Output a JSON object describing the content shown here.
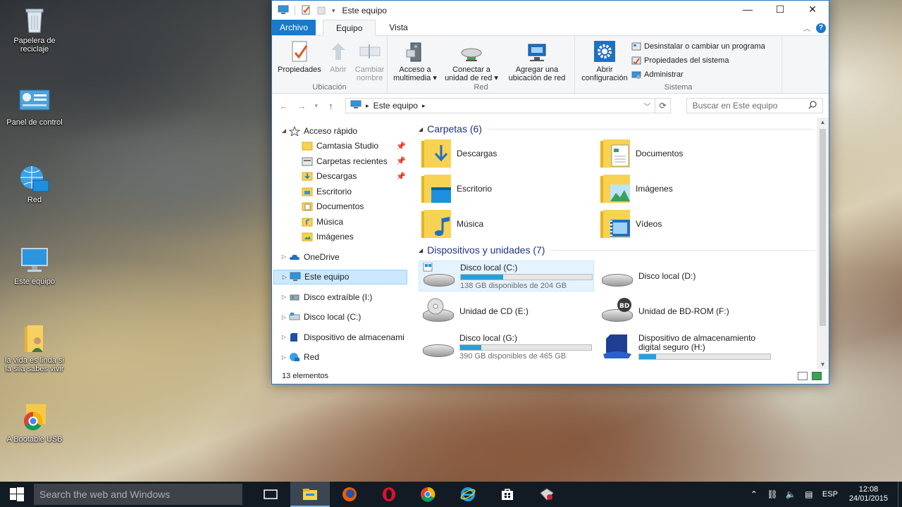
{
  "desktop": {
    "icons": [
      {
        "label": "Papelera de reciclaje"
      },
      {
        "label": "Panel de control"
      },
      {
        "label": "Red"
      },
      {
        "label": "Este equipo"
      },
      {
        "label": "la vida es linda si la sila sabes vivir"
      },
      {
        "label": "A Bootable USB"
      }
    ]
  },
  "window": {
    "title": "Este equipo",
    "controls": {
      "minimize": "—",
      "maximize": "☐",
      "close": "✕"
    },
    "tabs": {
      "file": "Archivo",
      "computer": "Equipo",
      "view": "Vista"
    },
    "ribbon": {
      "ubicacion": {
        "label": "Ubicación",
        "buttons": [
          {
            "label": "Propiedades"
          },
          {
            "label": "Abrir"
          },
          {
            "label": "Cambiar nombre"
          }
        ]
      },
      "red": {
        "label": "Red",
        "buttons": [
          {
            "label": "Acceso a multimedia ▾"
          },
          {
            "label": "Conectar a unidad de red ▾"
          },
          {
            "label": "Agregar una ubicación de red"
          }
        ]
      },
      "sistema": {
        "label": "Sistema",
        "open_settings": "Abrir configuración",
        "items": [
          {
            "label": "Desinstalar o cambiar un programa"
          },
          {
            "label": "Propiedades del sistema"
          },
          {
            "label": "Administrar"
          }
        ]
      }
    },
    "address": {
      "path": "Este equipo",
      "search_placeholder": "Buscar en Este equipo"
    },
    "nav": {
      "quick_access": "Acceso rápido",
      "quick_items": [
        {
          "label": "Camtasia Studio"
        },
        {
          "label": "Carpetas recientes"
        },
        {
          "label": "Descargas"
        },
        {
          "label": "Escritorio"
        },
        {
          "label": "Documentos"
        },
        {
          "label": "Música"
        },
        {
          "label": "Imágenes"
        }
      ],
      "onedrive": "OneDrive",
      "this_pc": "Este equipo",
      "others": [
        {
          "label": "Disco extraíble (I:)"
        },
        {
          "label": "Disco local (C:)"
        },
        {
          "label": "Dispositivo de almacenami"
        },
        {
          "label": "Red"
        }
      ]
    },
    "folders_header": "Carpetas (6)",
    "folders": [
      {
        "label": "Descargas"
      },
      {
        "label": "Documentos"
      },
      {
        "label": "Escritorio"
      },
      {
        "label": "Imágenes"
      },
      {
        "label": "Música"
      },
      {
        "label": "Vídeos"
      }
    ],
    "devices_header": "Dispositivos y unidades (7)",
    "drives": [
      {
        "label": "Disco local (C:)",
        "sub": "138 GB disponibles de 204 GB",
        "used_fraction": 0.32
      },
      {
        "label": "Disco local (D:)"
      },
      {
        "label": "Unidad de CD (E:)"
      },
      {
        "label": "Unidad de BD-ROM (F:)"
      },
      {
        "label": "Disco local (G:)",
        "sub": "390 GB disponibles de 465 GB",
        "used_fraction": 0.16
      },
      {
        "label": "Dispositivo de almacenamiento digital seguro (H:)",
        "used_fraction": 0.13
      }
    ],
    "status": "13 elementos"
  },
  "taskbar": {
    "search_placeholder": "Search the web and Windows",
    "language": "ESP",
    "time": "12:08",
    "date": "24/01/2015"
  },
  "colors": {
    "accent": "#1979ca",
    "selection": "#cce8ff",
    "bar_fill": "#26a0da",
    "taskbar": "#121b24"
  }
}
